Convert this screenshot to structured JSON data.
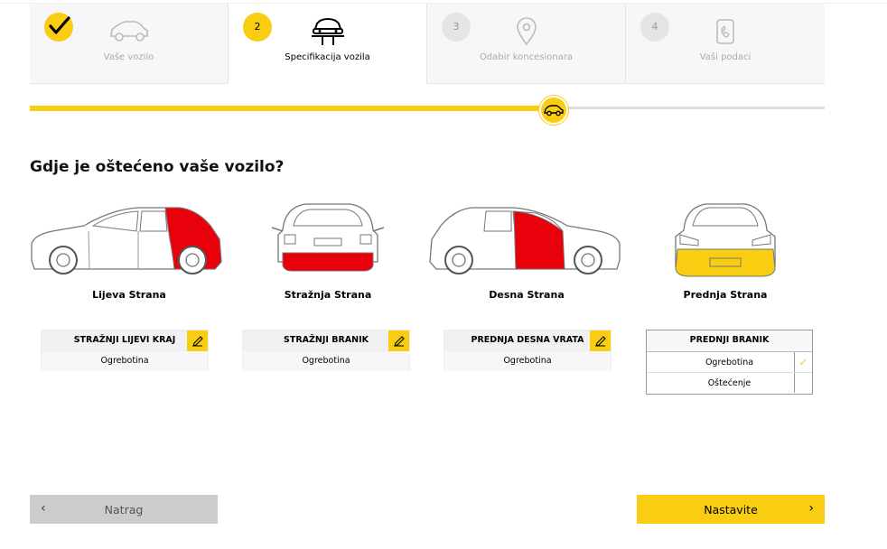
{
  "steps": [
    {
      "number": "",
      "label": "Vaše vozilo",
      "state": "done",
      "icon": "car-outline-icon"
    },
    {
      "number": "2",
      "label": "Specifikacija vozila",
      "state": "active",
      "icon": "car-lift-icon"
    },
    {
      "number": "3",
      "label": "Odabir koncesionara",
      "state": "pending",
      "icon": "location-pin-icon"
    },
    {
      "number": "4",
      "label": "Vaši podaci",
      "state": "pending",
      "icon": "phone-icon"
    }
  ],
  "progress": {
    "fraction": 0.66
  },
  "question": "Gdje je oštećeno vaše vozilo?",
  "views": [
    {
      "label": "Lijeva Strana"
    },
    {
      "label": "Stražnja Strana"
    },
    {
      "label": "Desna Strana"
    },
    {
      "label": "Prednja Strana"
    }
  ],
  "damages": [
    {
      "part": "STRAŽNJI LIJEVI KRAJ",
      "type": "Ogrebotina"
    },
    {
      "part": "STRAŽNJI BRANIK",
      "type": "Ogrebotina"
    },
    {
      "part": "PREDNJA DESNA VRATA",
      "type": "Ogrebotina"
    }
  ],
  "dropdown": {
    "part": "PREDNJI BRANIK",
    "options": [
      {
        "label": "Ogrebotina",
        "selected": true,
        "mark": "✓"
      },
      {
        "label": "Oštećenje",
        "selected": false,
        "mark": ""
      }
    ]
  },
  "buttons": {
    "back": "Natrag",
    "next": "Nastavite"
  },
  "colors": {
    "accent": "#f8cd12",
    "damage_red": "#e8000b",
    "damage_yellow": "#f8cd12"
  }
}
